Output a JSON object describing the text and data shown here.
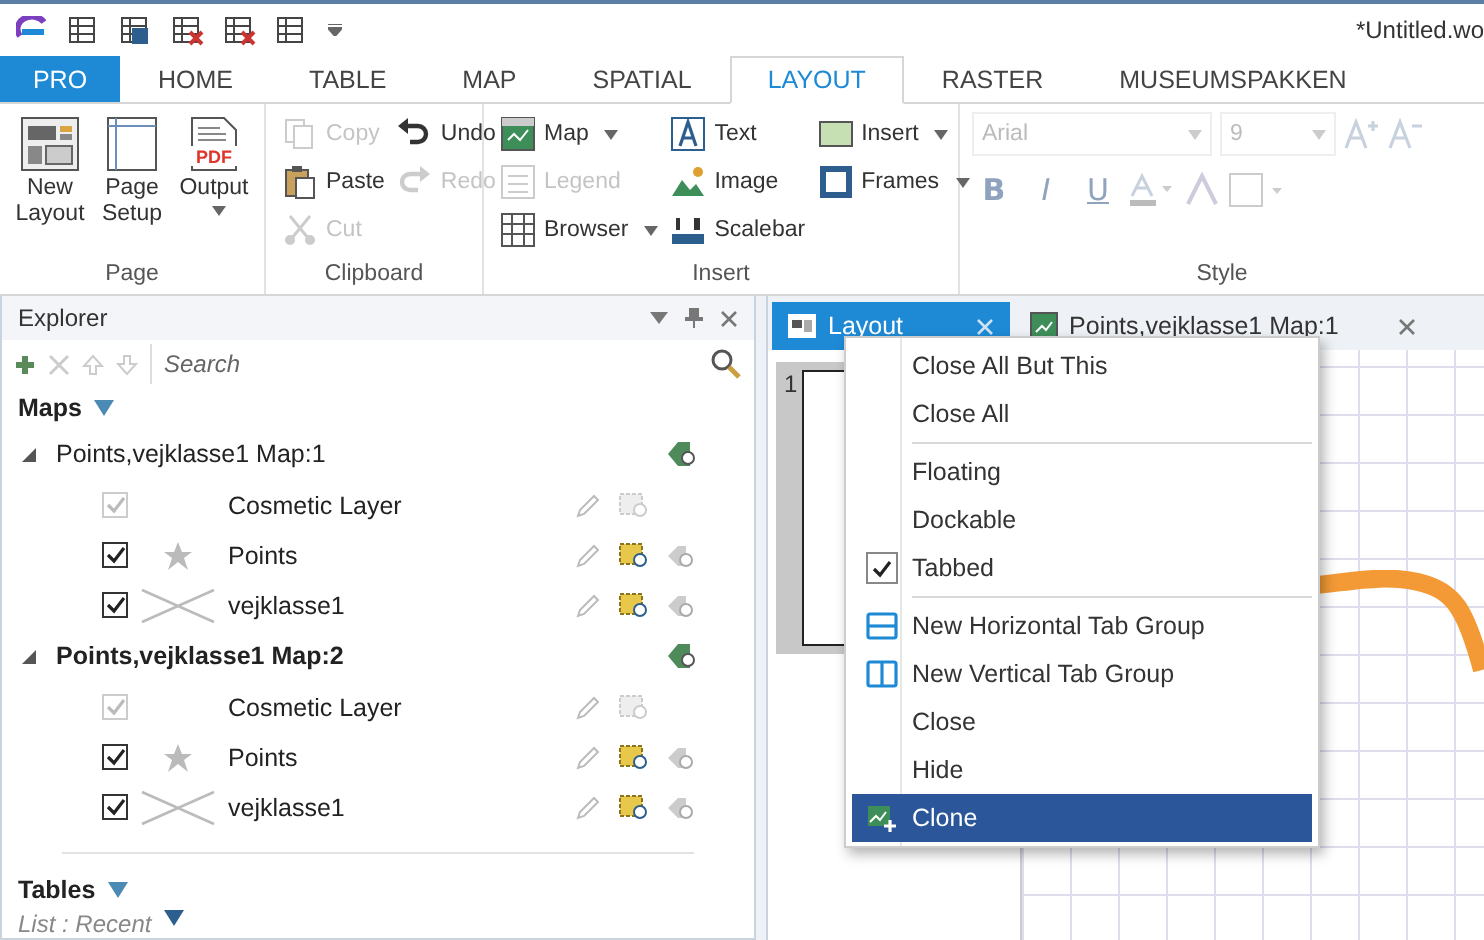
{
  "window": {
    "title": "*Untitled.wo"
  },
  "ribbon_tabs": [
    {
      "label": "PRO",
      "kind": "app",
      "selected": false
    },
    {
      "label": "HOME",
      "kind": "tab",
      "selected": false
    },
    {
      "label": "TABLE",
      "kind": "tab",
      "selected": false
    },
    {
      "label": "MAP",
      "kind": "tab",
      "selected": false
    },
    {
      "label": "SPATIAL",
      "kind": "tab",
      "selected": false
    },
    {
      "label": "LAYOUT",
      "kind": "tab",
      "selected": true
    },
    {
      "label": "RASTER",
      "kind": "tab",
      "selected": false
    },
    {
      "label": "MUSEUMSPAKKEN",
      "kind": "tab",
      "selected": false
    }
  ],
  "ribbon": {
    "page": {
      "label": "Page",
      "buttons": [
        {
          "label": "New Layout",
          "dropdown": false
        },
        {
          "label": "Page Setup",
          "dropdown": false
        },
        {
          "label": "Output",
          "icon_text": "PDF",
          "dropdown": true
        }
      ]
    },
    "clipboard": {
      "label": "Clipboard",
      "columns": [
        [
          {
            "label": "Copy",
            "disabled": true
          },
          {
            "label": "Paste",
            "disabled": false
          },
          {
            "label": "Cut",
            "disabled": true
          }
        ],
        [
          {
            "label": "Undo",
            "disabled": false
          },
          {
            "label": "Redo",
            "disabled": true
          }
        ]
      ]
    },
    "insert": {
      "label": "Insert",
      "columns": [
        [
          {
            "label": "Map",
            "disabled": false,
            "dropdown": true
          },
          {
            "label": "Legend",
            "disabled": true,
            "dropdown": false
          },
          {
            "label": "Browser",
            "disabled": false,
            "dropdown": true
          }
        ],
        [
          {
            "label": "Text",
            "disabled": false,
            "dropdown": false
          },
          {
            "label": "Image",
            "disabled": false,
            "dropdown": false
          },
          {
            "label": "Scalebar",
            "disabled": false,
            "dropdown": false
          }
        ],
        [
          {
            "label": "Insert",
            "disabled": false,
            "dropdown": true
          },
          {
            "label": "Frames",
            "disabled": false,
            "dropdown": true
          }
        ]
      ]
    },
    "style": {
      "label": "Style",
      "font": "Arial",
      "size": "9",
      "disabled": true,
      "format_buttons": [
        "B",
        "I",
        "U"
      ]
    }
  },
  "explorer": {
    "title": "Explorer",
    "search": {
      "placeholder": "Search"
    },
    "maps_heading": "Maps",
    "maps": [
      {
        "name": "Points,vejklasse1 Map:1",
        "active": false,
        "expanded": true,
        "layers": [
          {
            "name": "Cosmetic Layer",
            "kind": "cosmetic",
            "checked": true,
            "disabled": true
          },
          {
            "name": "Points",
            "kind": "point",
            "checked": true,
            "disabled": false
          },
          {
            "name": "vejklasse1",
            "kind": "line",
            "checked": true,
            "disabled": false
          }
        ]
      },
      {
        "name": "Points,vejklasse1 Map:2",
        "active": true,
        "expanded": true,
        "layers": [
          {
            "name": "Cosmetic Layer",
            "kind": "cosmetic",
            "checked": true,
            "disabled": true
          },
          {
            "name": "Points",
            "kind": "point",
            "checked": true,
            "disabled": false
          },
          {
            "name": "vejklasse1",
            "kind": "line",
            "checked": true,
            "disabled": false
          }
        ]
      }
    ],
    "tables_heading": "Tables",
    "tables_list": "List : Recent"
  },
  "document_tabs": [
    {
      "label": "Layout",
      "kind": "layout",
      "selected": true
    },
    {
      "label": "Points,vejklasse1 Map:1",
      "kind": "map",
      "selected": false
    }
  ],
  "layout_page": {
    "number": "1"
  },
  "context_menu": {
    "groups": [
      [
        {
          "label": "Close All But This",
          "checked": false,
          "selected": false
        },
        {
          "label": "Close All",
          "checked": false,
          "selected": false
        }
      ],
      [
        {
          "label": "Floating",
          "checked": false,
          "selected": false
        },
        {
          "label": "Dockable",
          "checked": false,
          "selected": false
        },
        {
          "label": "Tabbed",
          "checked": true,
          "selected": false
        }
      ],
      [
        {
          "label": "New Horizontal Tab Group",
          "checked": false,
          "selected": false
        },
        {
          "label": "New Vertical Tab Group",
          "checked": false,
          "selected": false
        },
        {
          "label": "Close",
          "checked": false,
          "selected": false
        },
        {
          "label": "Hide",
          "checked": false,
          "selected": false
        },
        {
          "label": "Clone",
          "checked": false,
          "selected": true
        }
      ]
    ]
  }
}
